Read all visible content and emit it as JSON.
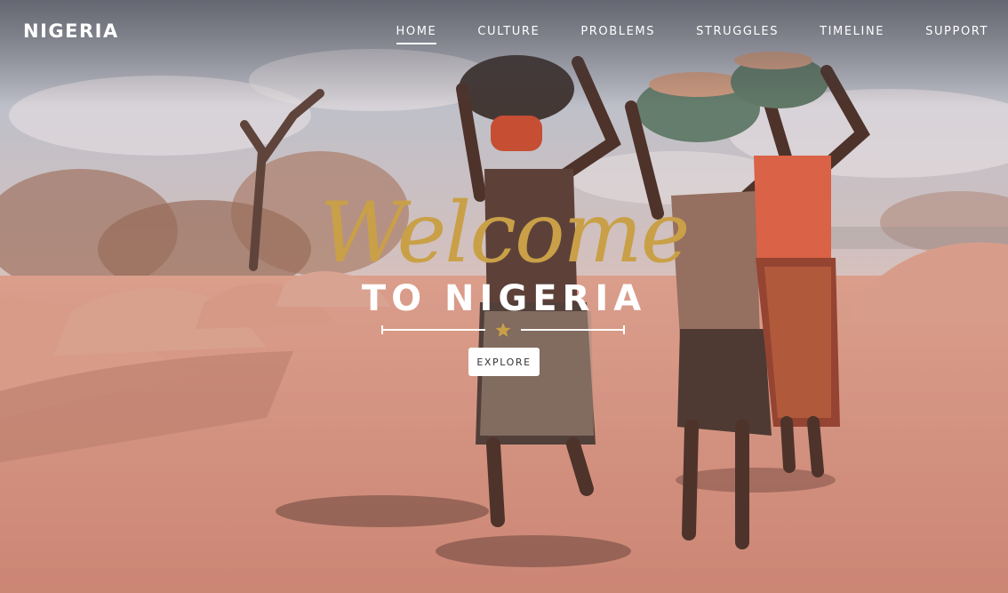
{
  "header": {
    "logo": "NIGERIA",
    "nav": [
      {
        "label": "HOME",
        "active": true
      },
      {
        "label": "CULTURE",
        "active": false
      },
      {
        "label": "PROBLEMS",
        "active": false
      },
      {
        "label": "STRUGGLES",
        "active": false
      },
      {
        "label": "TIMELINE",
        "active": false
      },
      {
        "label": "SUPPORT",
        "active": false
      }
    ]
  },
  "hero": {
    "welcome": "Welcome",
    "subtitle": "TO NIGERIA",
    "explore_label": "EXPLORE",
    "divider_icon": "star-icon"
  },
  "colors": {
    "accent_gold": "#c9a047",
    "text_white": "#ffffff",
    "button_bg": "#ffffff",
    "ground": "#c98a78",
    "sky": "#b7c6d6"
  }
}
